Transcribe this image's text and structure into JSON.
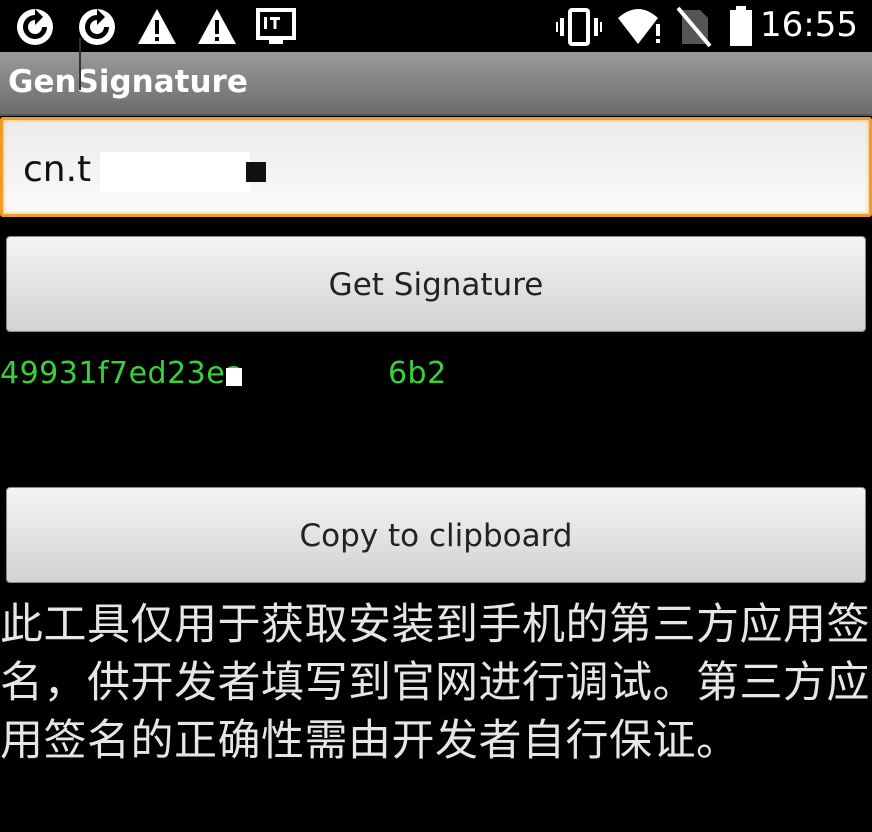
{
  "status_bar": {
    "time": "16:55",
    "notification_icons": [
      "sync-icon",
      "sync-icon",
      "warning-icon",
      "warning-icon",
      "it-icon"
    ],
    "system_icons": [
      "vibrate-icon",
      "wifi-icon",
      "no-sim-icon",
      "battery-icon"
    ]
  },
  "app": {
    "title": "GenSignature"
  },
  "package_input": {
    "value": "cn.t        hi"
  },
  "buttons": {
    "get_signature": "Get Signature",
    "copy_clipboard": "Copy to clipboard"
  },
  "signature": {
    "text": "49931f7ed23ea             3a02c446b2"
  },
  "info": {
    "text": "此工具仅用于获取安装到手机的第三方应用签名，供开发者填写到官网进行调试。第三方应用签名的正确性需由开发者自行保证。"
  },
  "colors": {
    "accent": "#f39a24",
    "signature": "#37d13a",
    "title_bar": "#8a8a8a"
  }
}
